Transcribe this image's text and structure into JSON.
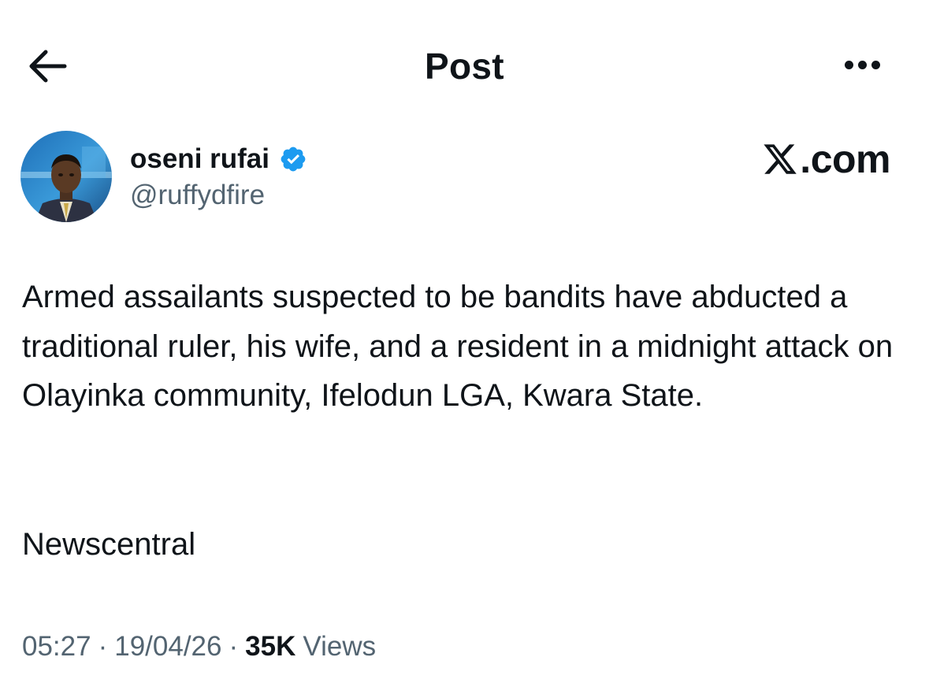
{
  "header": {
    "title": "Post",
    "back_icon": "arrow-left-icon",
    "more_icon": "more-horizontal-icon"
  },
  "author": {
    "display_name": "oseni rufai",
    "handle": "@ruffydfire",
    "verified": true,
    "verified_color": "#1d9bf0"
  },
  "watermark": {
    "text": ".com",
    "logo_icon": "x-logo-icon"
  },
  "post": {
    "text": "Armed assailants suspected to be bandits have abducted a traditional ruler, his wife, and a resident in a midnight attack on Olayinka community, Ifelodun LGA, Kwara State.",
    "source": "Newscentral"
  },
  "meta": {
    "time": "05:27",
    "separator": "·",
    "date": "19/04/26",
    "views_count": "35K",
    "views_label": "Views"
  },
  "colors": {
    "text_primary": "#0f1419",
    "text_secondary": "#536471",
    "background": "#ffffff"
  }
}
